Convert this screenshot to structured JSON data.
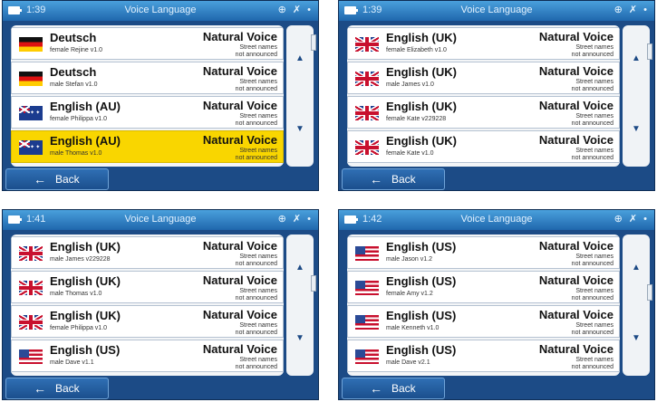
{
  "screens": [
    {
      "time": "1:39",
      "title": "Voice Language",
      "status_icons": "⊕ ✗ •",
      "items": [
        {
          "flag": "germany-flag",
          "language": "Deutsch",
          "voice": "female Rejine v1.0",
          "voice_type": "Natural Voice",
          "street1": "Street names",
          "street2": "not announced",
          "selected": false
        },
        {
          "flag": "germany-flag",
          "language": "Deutsch",
          "voice": "male Stefan v1.0",
          "voice_type": "Natural Voice",
          "street1": "Street names",
          "street2": "not announced",
          "selected": false
        },
        {
          "flag": "australia-flag",
          "language": "English (AU)",
          "voice": "female Philippa v1.0",
          "voice_type": "Natural Voice",
          "street1": "Street names",
          "street2": "not announced",
          "selected": false
        },
        {
          "flag": "australia-flag",
          "language": "English (AU)",
          "voice": "male Thomas v1.0",
          "voice_type": "Natural Voice",
          "street1": "Street names",
          "street2": "not announced",
          "selected": true
        }
      ],
      "back_label": "Back",
      "scroll_up": "▲",
      "scroll_down": "▼"
    },
    {
      "time": "1:39",
      "title": "Voice Language",
      "status_icons": "⊕ ✗ •",
      "items": [
        {
          "flag": "uk-flag",
          "language": "English (UK)",
          "voice": "female Elizabeth v1.0",
          "voice_type": "Natural Voice",
          "street1": "Street names",
          "street2": "not announced",
          "selected": false
        },
        {
          "flag": "uk-flag",
          "language": "English (UK)",
          "voice": "male James v1.0",
          "voice_type": "Natural Voice",
          "street1": "Street names",
          "street2": "not announced",
          "selected": false
        },
        {
          "flag": "uk-flag",
          "language": "English (UK)",
          "voice": "female Kate v229228",
          "voice_type": "Natural Voice",
          "street1": "Street names",
          "street2": "not announced",
          "selected": false
        },
        {
          "flag": "uk-flag",
          "language": "English (UK)",
          "voice": "female Kate v1.0",
          "voice_type": "Natural Voice",
          "street1": "Street names",
          "street2": "not announced",
          "selected": false
        }
      ],
      "back_label": "Back",
      "scroll_up": "▲",
      "scroll_down": "▼"
    },
    {
      "time": "1:41",
      "title": "Voice Language",
      "status_icons": "⊕ ✗ •",
      "items": [
        {
          "flag": "uk-flag",
          "language": "English (UK)",
          "voice": "male James v229228",
          "voice_type": "Natural Voice",
          "street1": "Street names",
          "street2": "not announced",
          "selected": false
        },
        {
          "flag": "uk-flag",
          "language": "English (UK)",
          "voice": "male Thomas v1.0",
          "voice_type": "Natural Voice",
          "street1": "Street names",
          "street2": "not announced",
          "selected": false
        },
        {
          "flag": "uk-flag",
          "language": "English (UK)",
          "voice": "female Philippa v1.0",
          "voice_type": "Natural Voice",
          "street1": "Street names",
          "street2": "not announced",
          "selected": false
        },
        {
          "flag": "us-flag",
          "language": "English (US)",
          "voice": "male Dave v1.1",
          "voice_type": "Natural Voice",
          "street1": "Street names",
          "street2": "not announced",
          "selected": false
        }
      ],
      "back_label": "Back",
      "scroll_up": "▲",
      "scroll_down": "▼"
    },
    {
      "time": "1:42",
      "title": "Voice Language",
      "status_icons": "⊕ ✗ •",
      "items": [
        {
          "flag": "us-flag",
          "language": "English (US)",
          "voice": "male Jason v1.2",
          "voice_type": "Natural Voice",
          "street1": "Street names",
          "street2": "not announced",
          "selected": false
        },
        {
          "flag": "us-flag",
          "language": "English (US)",
          "voice": "female Amy v1.2",
          "voice_type": "Natural Voice",
          "street1": "Street names",
          "street2": "not announced",
          "selected": false
        },
        {
          "flag": "us-flag",
          "language": "English (US)",
          "voice": "male Kenneth v1.0",
          "voice_type": "Natural Voice",
          "street1": "Street names",
          "street2": "not announced",
          "selected": false
        },
        {
          "flag": "us-flag",
          "language": "English (US)",
          "voice": "male Dave v2.1",
          "voice_type": "Natural Voice",
          "street1": "Street names",
          "street2": "not announced",
          "selected": false
        }
      ],
      "back_label": "Back",
      "scroll_up": "▲",
      "scroll_down": "▼"
    }
  ],
  "colors": {
    "header": "#2b7fc8",
    "background": "#1c4b86",
    "selected": "#f9d600",
    "list_bg": "#ffffff"
  }
}
